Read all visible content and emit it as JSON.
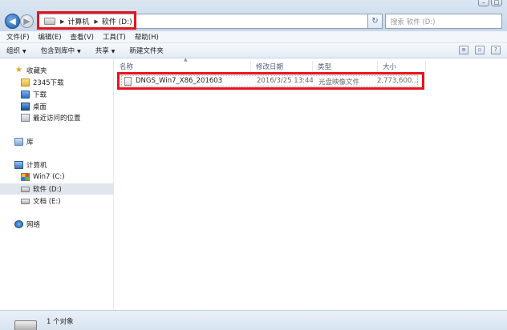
{
  "window": {
    "controls": [
      "–",
      "□"
    ]
  },
  "address": {
    "crumbs": [
      "计算机",
      "软件 (D:)"
    ],
    "search_placeholder": "搜索 软件 (D:)"
  },
  "menu": [
    "文件(F)",
    "编辑(E)",
    "查看(V)",
    "工具(T)",
    "帮助(H)"
  ],
  "toolbar": {
    "organize": "组织",
    "include_in_library": "包含到库中",
    "share": "共享",
    "new_folder": "新建文件夹"
  },
  "nav": {
    "favorites": "收藏夹",
    "fav_items": [
      "2345下载",
      "下载",
      "桌面",
      "最近访问的位置"
    ],
    "libraries": "库",
    "computer": "计算机",
    "drives": [
      "Win7 (C:)",
      "软件 (D:)",
      "文档 (E:)"
    ],
    "network": "网络"
  },
  "columns": {
    "name": "名称",
    "modified": "修改日期",
    "type": "类型",
    "size": "大小"
  },
  "files": [
    {
      "name": "DNGS_Win7_X86_201603",
      "modified": "2016/3/25 13:44",
      "type": "光盘映像文件",
      "size": "2,773,600..."
    }
  ],
  "status": {
    "count": "1 个对象"
  },
  "colors": {
    "highlight": "#e8141b"
  }
}
